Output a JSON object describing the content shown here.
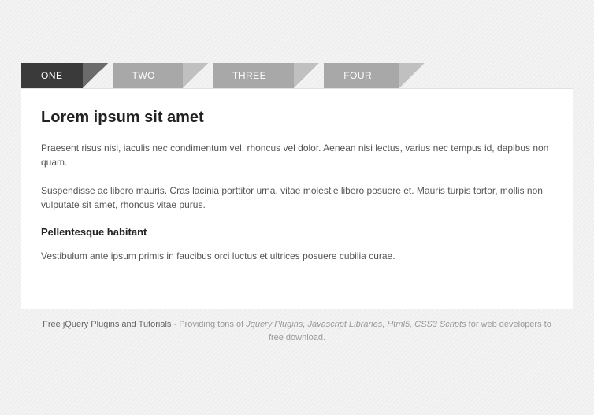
{
  "tabs": [
    {
      "label": "ONE",
      "active": true
    },
    {
      "label": "TWO",
      "active": false
    },
    {
      "label": "THREE",
      "active": false
    },
    {
      "label": "FOUR",
      "active": false
    }
  ],
  "content": {
    "heading": "Lorem ipsum sit amet",
    "para1": "Praesent risus nisi, iaculis nec condimentum vel, rhoncus vel dolor. Aenean nisi lectus, varius nec tempus id, dapibus non quam.",
    "para2": "Suspendisse ac libero mauris. Cras lacinia porttitor urna, vitae molestie libero posuere et. Mauris turpis tortor, mollis non vulputate sit amet, rhoncus vitae purus.",
    "subheading": "Pellentesque habitant",
    "para3": "Vestibulum ante ipsum primis in faucibus orci luctus et ultrices posuere cubilia curae."
  },
  "footer": {
    "link_text": "Free jQuery Plugins and Tutorials",
    "mid1": " - Providing tons of ",
    "emph": "Jquery Plugins, Javascript Libraries, Html5, CSS3 Scripts",
    "mid2": " for web developers to free download."
  }
}
